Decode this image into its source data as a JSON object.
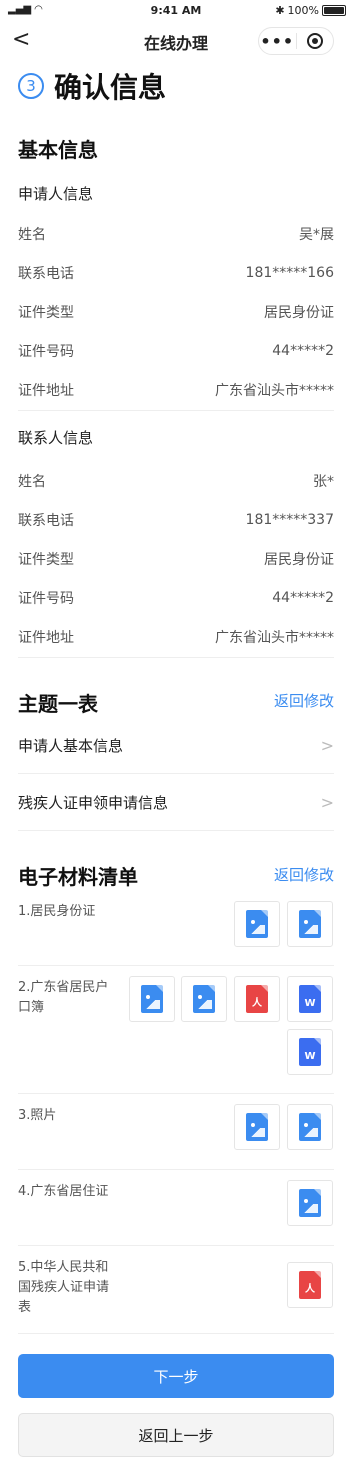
{
  "status_bar": {
    "time": "9:41 AM",
    "battery": "100%"
  },
  "nav": {
    "back": "<",
    "title": "在线办理",
    "more": "•••"
  },
  "step": {
    "number": "3",
    "title": "确认信息"
  },
  "basic": {
    "title": "基本信息",
    "applicant": {
      "title": "申请人信息",
      "rows": [
        {
          "k": "姓名",
          "v": "吴*展"
        },
        {
          "k": "联系电话",
          "v": "181*****166"
        },
        {
          "k": "证件类型",
          "v": "居民身份证"
        },
        {
          "k": "证件号码",
          "v": "44*****2"
        },
        {
          "k": "证件地址",
          "v": "广东省汕头市*****"
        }
      ]
    },
    "contact": {
      "title": "联系人信息",
      "rows": [
        {
          "k": "姓名",
          "v": "张*"
        },
        {
          "k": "联系电话",
          "v": "181*****337"
        },
        {
          "k": "证件类型",
          "v": "居民身份证"
        },
        {
          "k": "证件号码",
          "v": "44*****2"
        },
        {
          "k": "证件地址",
          "v": "广东省汕头市*****"
        }
      ]
    }
  },
  "theme": {
    "title": "主题一表",
    "link": "返回修改",
    "items": [
      "申请人基本信息",
      "残疾人证申领申请信息"
    ],
    "chevron": ">"
  },
  "materials": {
    "title": "电子材料清单",
    "link": "返回修改",
    "items": [
      {
        "label": "1.居民身份证",
        "files": [
          "image",
          "image"
        ]
      },
      {
        "label": "2.广东省居民户口簿",
        "files": [
          "image",
          "image",
          "pdf",
          "word",
          "word"
        ]
      },
      {
        "label": "3.照片",
        "files": [
          "image",
          "image"
        ]
      },
      {
        "label": "4.广东省居住证",
        "files": [
          "image"
        ]
      },
      {
        "label": "5.中华人民共和国残疾人证申请表",
        "files": [
          "pdf"
        ]
      }
    ],
    "glyphs": {
      "pdf": "人",
      "word": "W"
    }
  },
  "buttons": {
    "next": "下一步",
    "back": "返回上一步"
  },
  "colors": {
    "accent": "#3b8cf0",
    "pdf": "#e84545",
    "word": "#3b6df0"
  }
}
